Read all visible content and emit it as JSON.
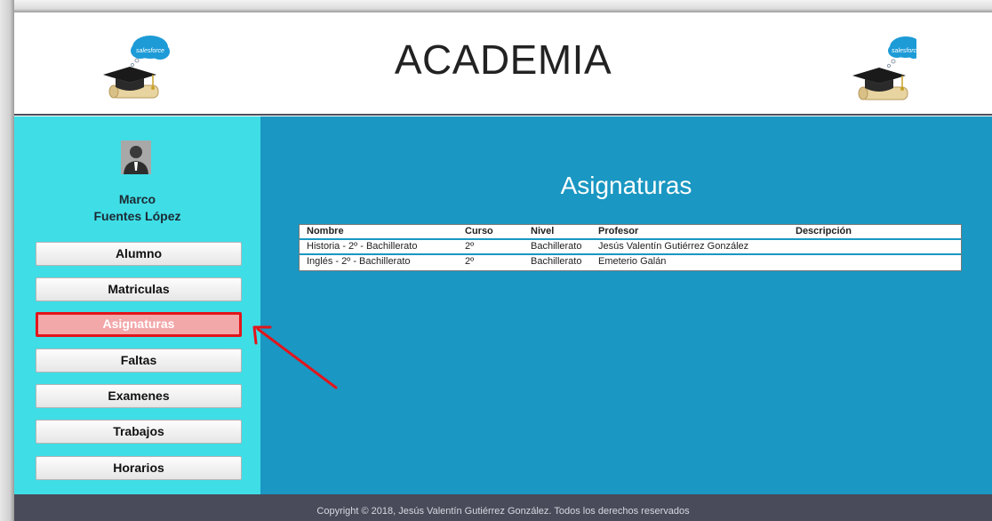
{
  "header": {
    "title": "ACADEMIA",
    "logo_left_text": "salesforce",
    "logo_right_text": "salesforce"
  },
  "sidebar": {
    "user_first": "Marco",
    "user_last": "Fuentes López",
    "items": [
      {
        "label": "Alumno",
        "active": false
      },
      {
        "label": "Matriculas",
        "active": false
      },
      {
        "label": "Asignaturas",
        "active": true
      },
      {
        "label": "Faltas",
        "active": false
      },
      {
        "label": "Examenes",
        "active": false
      },
      {
        "label": "Trabajos",
        "active": false
      },
      {
        "label": "Horarios",
        "active": false
      }
    ]
  },
  "main": {
    "title": "Asignaturas",
    "table": {
      "columns": [
        "Nombre",
        "Curso",
        "Nivel",
        "Profesor",
        "Descripción"
      ],
      "rows": [
        [
          "Historia - 2º - Bachillerato",
          "2º",
          "Bachillerato",
          "Jesús Valentín Gutiérrez González",
          ""
        ],
        [
          "Inglés - 2º - Bachillerato",
          "2º",
          "Bachillerato",
          "Emeterio Galán",
          ""
        ]
      ]
    }
  },
  "footer": {
    "copyright": "Copyright © 2018, Jesús Valentín Gutiérrez González. Todos los derechos reservados"
  },
  "colors": {
    "sidebar_bg": "#3fdde6",
    "main_bg": "#1a97c2",
    "footer_bg": "#4a4b5a",
    "active_border": "#e2151b",
    "annotation_arrow": "#e2151b"
  }
}
